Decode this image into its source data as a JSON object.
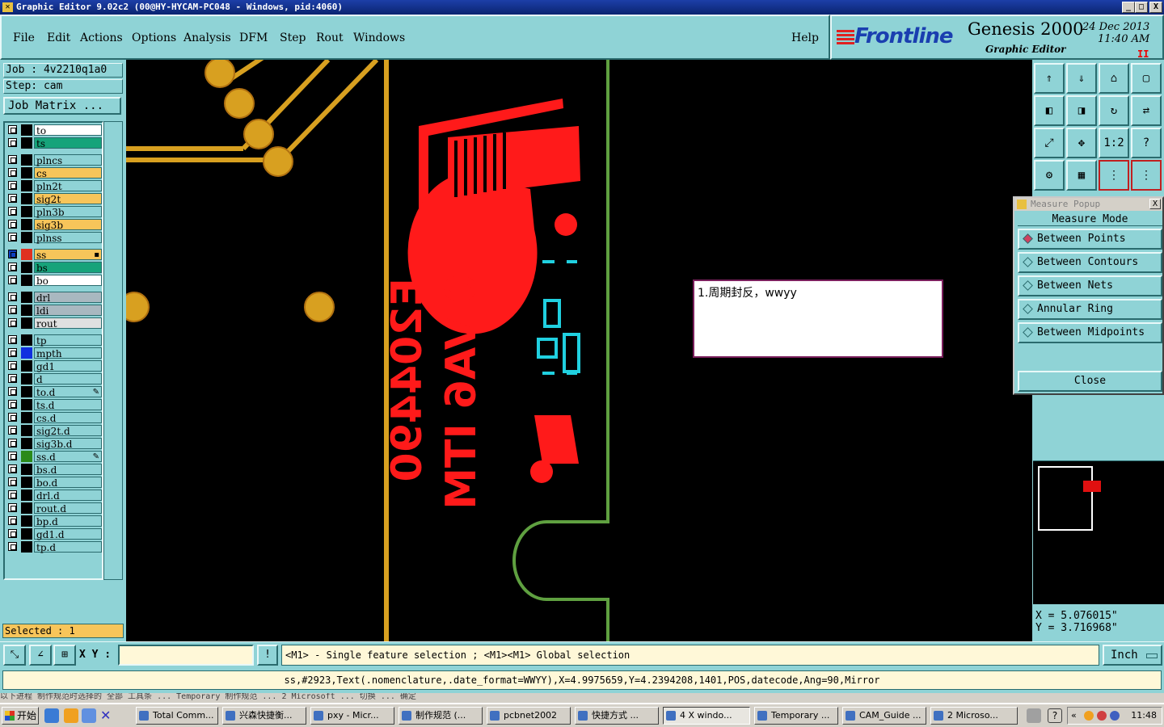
{
  "window": {
    "title": "Graphic Editor 9.02c2  (00@HY-HYCAM-PC048 - Windows, pid:4060)",
    "min": "_",
    "max": "□",
    "close": "X"
  },
  "menu": {
    "items": [
      "File",
      "Edit",
      "Actions",
      "Options",
      "Analysis",
      "DFM",
      "Step",
      "Rout",
      "Windows"
    ],
    "help": "Help"
  },
  "brand": {
    "logo": "Frontline",
    "product": "Genesis 2000",
    "subtitle": "Graphic Editor",
    "date": "24 Dec 2013",
    "time": "11:40 AM",
    "pause": "II"
  },
  "job": {
    "job_label": "Job : 4v2210q1a0",
    "step_label": "Step: cam",
    "matrix_button": "Job Matrix ..."
  },
  "layers": [
    {
      "name": "to",
      "color": "#ffffff",
      "swatch": "#000000",
      "group": 0
    },
    {
      "name": "ts",
      "color": "#16a37a",
      "swatch": "#000000",
      "group": 0
    },
    {
      "name": "plncs",
      "color": "#8fd3d6",
      "swatch": "#000000",
      "group": 1
    },
    {
      "name": "cs",
      "color": "#f7c55a",
      "swatch": "#000000",
      "group": 1
    },
    {
      "name": "pln2t",
      "color": "#8fd3d6",
      "swatch": "#000000",
      "group": 1
    },
    {
      "name": "sig2t",
      "color": "#f7c55a",
      "swatch": "#000000",
      "group": 1
    },
    {
      "name": "pln3b",
      "color": "#8fd3d6",
      "swatch": "#000000",
      "group": 1
    },
    {
      "name": "sig3b",
      "color": "#f7c55a",
      "swatch": "#000000",
      "group": 1
    },
    {
      "name": "plnss",
      "color": "#8fd3d6",
      "swatch": "#000000",
      "group": 1
    },
    {
      "name": "ss",
      "color": "#f7c55a",
      "swatch": "#e03020",
      "group": 2,
      "mark": "▪",
      "active": true
    },
    {
      "name": "bs",
      "color": "#16a37a",
      "swatch": "#000000",
      "group": 2
    },
    {
      "name": "bo",
      "color": "#ffffff",
      "swatch": "#000000",
      "group": 2
    },
    {
      "name": "drl",
      "color": "#a9b8c0",
      "swatch": "#000000",
      "group": 3
    },
    {
      "name": "ldi",
      "color": "#a9b8c0",
      "swatch": "#000000",
      "group": 3
    },
    {
      "name": "rout",
      "color": "#e0e0e0",
      "swatch": "#000000",
      "group": 3
    },
    {
      "name": "tp",
      "color": "#8fd3d6",
      "swatch": "#000000",
      "group": 4
    },
    {
      "name": "mpth",
      "color": "#8fd3d6",
      "swatch": "#1030e0",
      "group": 4
    },
    {
      "name": "gd1",
      "color": "#8fd3d6",
      "swatch": "#000000",
      "group": 4
    },
    {
      "name": "d",
      "color": "#8fd3d6",
      "swatch": "#000000",
      "group": 4
    },
    {
      "name": "to.d",
      "color": "#8fd3d6",
      "swatch": "#000000",
      "group": 4,
      "mark": "✎"
    },
    {
      "name": "ts.d",
      "color": "#8fd3d6",
      "swatch": "#000000",
      "group": 4
    },
    {
      "name": "cs.d",
      "color": "#8fd3d6",
      "swatch": "#000000",
      "group": 4
    },
    {
      "name": "sig2t.d",
      "color": "#8fd3d6",
      "swatch": "#000000",
      "group": 4
    },
    {
      "name": "sig3b.d",
      "color": "#8fd3d6",
      "swatch": "#000000",
      "group": 4
    },
    {
      "name": "ss.d",
      "color": "#8fd3d6",
      "swatch": "#2a8a1a",
      "group": 4,
      "mark": "✎"
    },
    {
      "name": "bs.d",
      "color": "#8fd3d6",
      "swatch": "#000000",
      "group": 4
    },
    {
      "name": "bo.d",
      "color": "#8fd3d6",
      "swatch": "#000000",
      "group": 4
    },
    {
      "name": "drl.d",
      "color": "#8fd3d6",
      "swatch": "#000000",
      "group": 4
    },
    {
      "name": "rout.d",
      "color": "#8fd3d6",
      "swatch": "#000000",
      "group": 4
    },
    {
      "name": "bp.d",
      "color": "#8fd3d6",
      "swatch": "#000000",
      "group": 4
    },
    {
      "name": "gd1.d",
      "color": "#8fd3d6",
      "swatch": "#000000",
      "group": 4
    },
    {
      "name": "tp.d",
      "color": "#8fd3d6",
      "swatch": "#000000",
      "group": 4
    }
  ],
  "selected": "Selected : 1",
  "board": {
    "silk_text_1": "E204490",
    "silk_text_2": "0-VA6 ITM",
    "copper_color": "#d8a020",
    "silk_color": "#ff1a1a",
    "outline_color": "#5fa040",
    "cyan_color": "#20d0e0"
  },
  "toolbar_icons": [
    "home-up-icon",
    "home-down-icon",
    "home-icon",
    "window-icon",
    "move-left-icon",
    "move-right-icon",
    "rotate-icon",
    "flip-icon",
    "zoom-fit-icon",
    "zoom-center-icon",
    "scale-1-2-icon",
    "help-question-icon",
    "settings-icon",
    "grid-icon",
    "measure-points-icon",
    "measure-nets-icon"
  ],
  "toolbar_labels": {
    "scale": "1:2",
    "help": "?"
  },
  "measure": {
    "title": "Measure Popup",
    "mode_label": "Measure Mode",
    "options": [
      {
        "label": "Between Points",
        "selected": true
      },
      {
        "label": "Between Contours",
        "selected": false
      },
      {
        "label": "Between Nets",
        "selected": false
      },
      {
        "label": "Annular Ring",
        "selected": false
      },
      {
        "label": "Between Midpoints",
        "selected": false
      }
    ],
    "close_label": "Close",
    "close_x": "X"
  },
  "coords": {
    "x": "X = 5.076015\"",
    "y": "Y = 3.716968\""
  },
  "note": {
    "text": "1.周期封反，wwyy"
  },
  "cmd": {
    "xy_label": "X Y :",
    "xy_value": "",
    "alert": "!",
    "message": "<M1> - Single feature selection ; <M1><M1> Global selection",
    "unit": "Inch"
  },
  "info": {
    "text": "ss,#2923,Text(.nomenclature,.date_format=WWYY),X=4.9975659,Y=4.2394208,1401,POS,datecode,Ang=90,Mirror"
  },
  "ghost_text": "以下进程 制作规范时选择的 全部 工具条  ...  Temporary  制作规范 ... 2 Microsoft ...  切换 ... 确定",
  "taskbar": {
    "start": "开始",
    "tasks": [
      {
        "label": "Total Comm...",
        "active": false
      },
      {
        "label": "兴森快捷衡...",
        "active": false
      },
      {
        "label": "pxy - Micr...",
        "active": false
      },
      {
        "label": "制作规范 (...",
        "active": false
      },
      {
        "label": "pcbnet2002",
        "active": false
      },
      {
        "label": "快捷方式 ...",
        "active": false
      },
      {
        "label": "4 X windo...",
        "active": true
      },
      {
        "label": "Temporary ...",
        "active": false
      },
      {
        "label": "CAM_Guide ...",
        "active": false
      },
      {
        "label": "2 Microso...",
        "active": false
      }
    ],
    "tray_arrow": "«",
    "clock": "11:48"
  }
}
